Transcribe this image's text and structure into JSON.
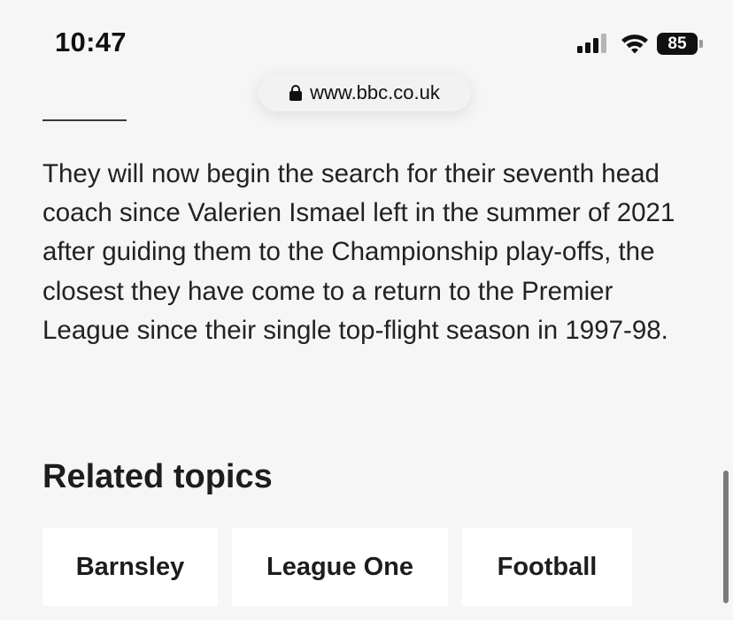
{
  "status_bar": {
    "time": "10:47",
    "battery": "85",
    "icons": [
      "cellular-signal-icon",
      "wifi-icon",
      "battery-icon"
    ]
  },
  "address_bar": {
    "url": "www.bbc.co.uk",
    "icon": "lock-icon"
  },
  "article": {
    "paragraph": "They will now begin the search for their seventh head coach since Valerien Ismael left in the summer of 2021 after guiding them to the Championship play-offs, the closest they have come to a return to the Premier League since their single top-flight season in 1997-98."
  },
  "related": {
    "heading": "Related topics",
    "topics": [
      {
        "label": "Barnsley"
      },
      {
        "label": "League One"
      },
      {
        "label": "Football"
      }
    ]
  }
}
